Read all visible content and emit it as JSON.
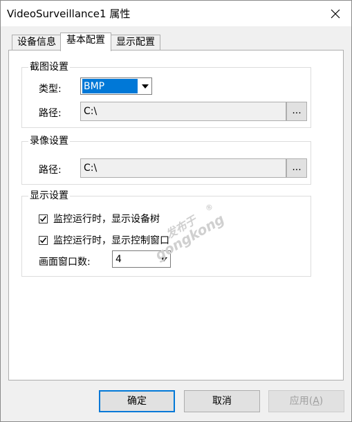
{
  "window": {
    "title": "VideoSurveillance1 属性"
  },
  "tabs": [
    {
      "label": "设备信息"
    },
    {
      "label": "基本配置"
    },
    {
      "label": "显示配置"
    }
  ],
  "capture": {
    "group_label": "截图设置",
    "type_label": "类型:",
    "type_value": "BMP",
    "path_label": "路径:",
    "path_value": "C:\\",
    "browse_label": "..."
  },
  "record": {
    "group_label": "录像设置",
    "path_label": "路径:",
    "path_value": "C:\\",
    "browse_label": "..."
  },
  "display": {
    "group_label": "显示设置",
    "checkboxes": [
      {
        "label": "监控运行时，显示设备树",
        "checked": true
      },
      {
        "label": "监控运行时，显示控制窗口",
        "checked": true
      }
    ],
    "window_count_label": "画面窗口数:",
    "window_count_value": "4"
  },
  "buttons": {
    "ok": "确定",
    "cancel": "取消",
    "apply_text": "应用(",
    "apply_key": "A",
    "apply_close": ")"
  },
  "watermark": {
    "cn": "发布于",
    "en": "gongkong",
    "reg": "®"
  },
  "icons": {
    "close": "close-icon",
    "dropdown": "chevron-down-icon",
    "check": "checkmark-icon"
  }
}
